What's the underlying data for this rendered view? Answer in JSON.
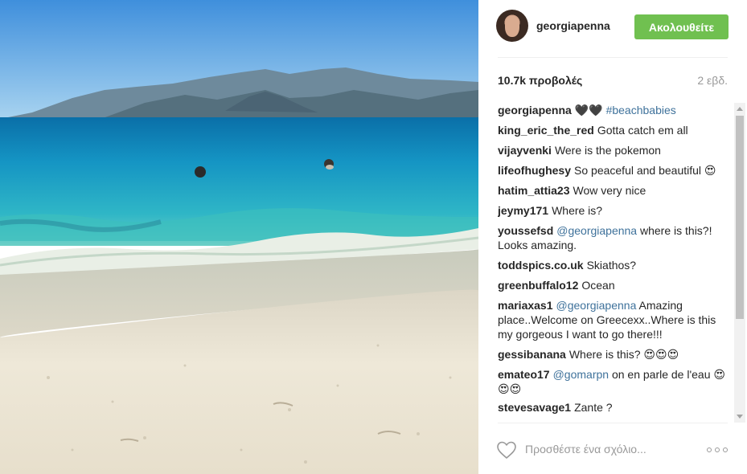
{
  "post": {
    "username": "georgiapenna",
    "follow_label": "Ακολουθείτε",
    "views": "10.7k προβολές",
    "age": "2 εβδ."
  },
  "comments": [
    {
      "author": "georgiapenna",
      "text": "🖤🖤",
      "link": "#beachbabies",
      "after": ""
    },
    {
      "author": "king_eric_the_red",
      "text": "Gotta catch em all",
      "link": "",
      "after": ""
    },
    {
      "author": "vijayvenki",
      "text": "Were is the pokemon",
      "link": "",
      "after": ""
    },
    {
      "author": "lifeofhughesy",
      "text": "So peaceful and beautiful 😍",
      "link": "",
      "after": ""
    },
    {
      "author": "hatim_attia23",
      "text": "Wow very nice",
      "link": "",
      "after": ""
    },
    {
      "author": "jeymy171",
      "text": "Where is?",
      "link": "",
      "after": ""
    },
    {
      "author": "youssefsd",
      "text": "",
      "link": "@georgiapenna",
      "after": "where is this?! Looks amazing."
    },
    {
      "author": "toddspics.co.uk",
      "text": "Skiathos?",
      "link": "",
      "after": ""
    },
    {
      "author": "greenbuffalo12",
      "text": "Ocean",
      "link": "",
      "after": ""
    },
    {
      "author": "mariaxas1",
      "text": "",
      "link": "@georgiapenna",
      "after": "Amazing place..Welcome on Greecexx..Where is this my gorgeous I want to go there!!!"
    },
    {
      "author": "gessibanana",
      "text": "Where is this? 😍😍😍",
      "link": "",
      "after": ""
    },
    {
      "author": "emateo17",
      "text": "",
      "link": "@gomarpn",
      "after": "on en parle de l'eau 😍😍😍"
    },
    {
      "author": "stevesavage1",
      "text": "Zante ?",
      "link": "",
      "after": ""
    }
  ],
  "add_comment": {
    "placeholder": "Προσθέστε ένα σχόλιο..."
  },
  "icons": {
    "like": "heart-icon",
    "more": "more-options-icon"
  },
  "colors": {
    "follow_button": "#70c050",
    "link": "#3f729b",
    "muted": "#999999"
  }
}
